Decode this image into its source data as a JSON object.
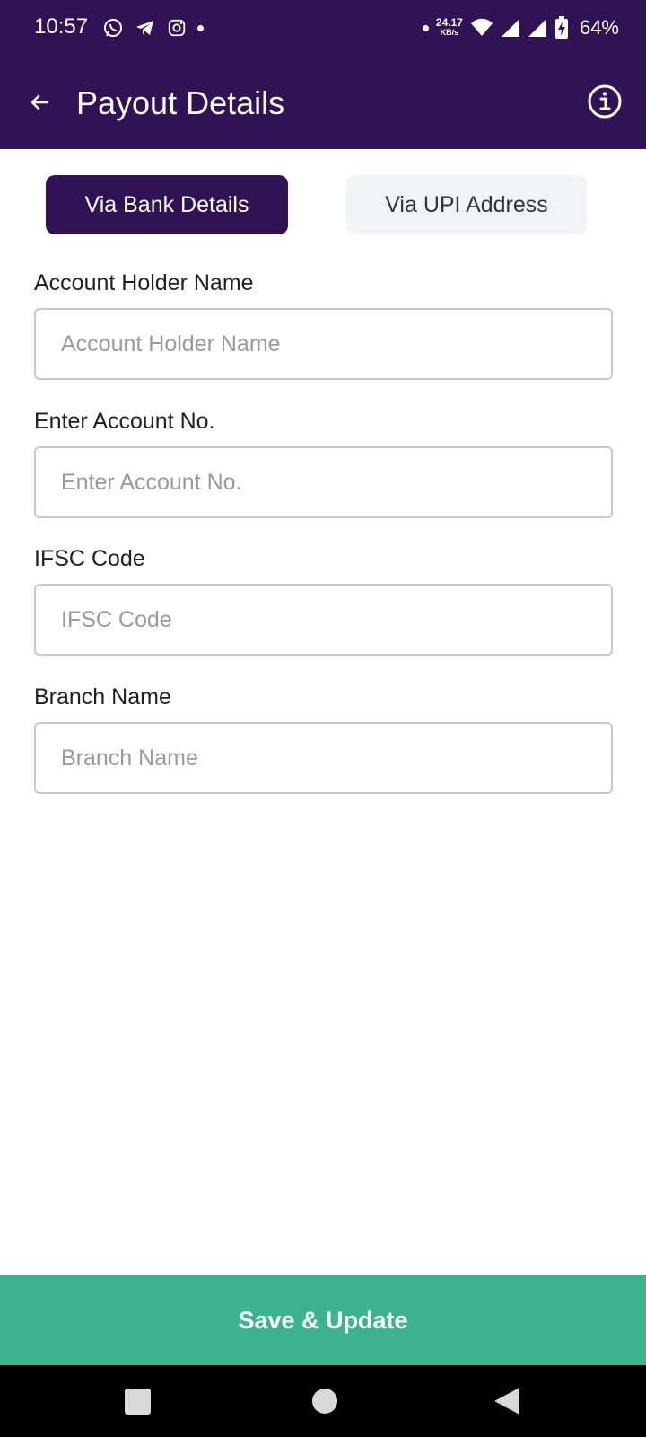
{
  "status_bar": {
    "time": "10:57",
    "left_icons": [
      "whatsapp-icon",
      "telegram-icon",
      "instagram-icon",
      "dot-icon"
    ],
    "net_speed_value": "24.17",
    "net_speed_unit": "KB/s",
    "battery_percent": "64%"
  },
  "app_bar": {
    "title": "Payout Details",
    "back_icon": "arrow-left-icon",
    "info_icon": "info-icon"
  },
  "tabs": [
    {
      "label": "Via Bank Details",
      "active": true
    },
    {
      "label": "Via UPI Address",
      "active": false
    }
  ],
  "form": {
    "fields": [
      {
        "label": "Account Holder Name",
        "placeholder": "Account Holder Name",
        "value": ""
      },
      {
        "label": "Enter Account No.",
        "placeholder": "Enter Account No.",
        "value": ""
      },
      {
        "label": "IFSC Code",
        "placeholder": "IFSC Code",
        "value": ""
      },
      {
        "label": "Branch Name",
        "placeholder": "Branch Name",
        "value": ""
      }
    ]
  },
  "save_button": {
    "label": "Save & Update"
  },
  "colors": {
    "primary": "#311254",
    "accent": "#3bb38c",
    "tab_inactive_bg": "#f2f3f5"
  }
}
